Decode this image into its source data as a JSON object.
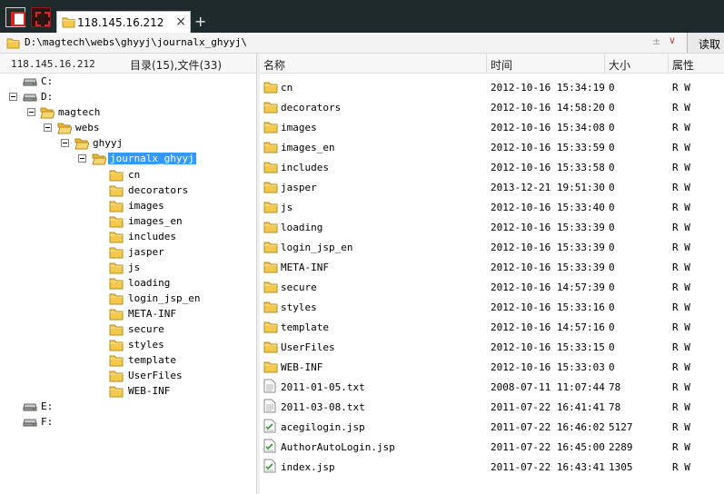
{
  "tab": {
    "title": "118.145.16.212",
    "close": "×",
    "new_tab": "+"
  },
  "address": {
    "path": "D:\\magtech\\webs\\ghyyj\\journalx_ghyyj\\",
    "scroll_glyph": "±",
    "dropdown_glyph": "∨",
    "read_label": "读取"
  },
  "left_header": {
    "host": "118.145.16.212",
    "counts": "目录(15),文件(33)"
  },
  "tree": {
    "c": "C:",
    "d": "D:",
    "magtech": "magtech",
    "webs": "webs",
    "ghyyj": "ghyyj",
    "journalx": "journalx_ghyyj",
    "e": "E:",
    "f": "F:",
    "children": [
      "cn",
      "decorators",
      "images",
      "images_en",
      "includes",
      "jasper",
      "js",
      "loading",
      "login_jsp_en",
      "META-INF",
      "secure",
      "styles",
      "template",
      "UserFiles",
      "WEB-INF"
    ]
  },
  "columns": {
    "name": "名称",
    "time": "时间",
    "size": "大小",
    "attr": "属性"
  },
  "files": [
    {
      "name": "cn",
      "time": "2012-10-16 15:34:19",
      "size": "0",
      "attr": "R W",
      "type": "folder"
    },
    {
      "name": "decorators",
      "time": "2012-10-16 14:58:20",
      "size": "0",
      "attr": "R W",
      "type": "folder"
    },
    {
      "name": "images",
      "time": "2012-10-16 15:34:08",
      "size": "0",
      "attr": "R W",
      "type": "folder"
    },
    {
      "name": "images_en",
      "time": "2012-10-16 15:33:59",
      "size": "0",
      "attr": "R W",
      "type": "folder"
    },
    {
      "name": "includes",
      "time": "2012-10-16 15:33:58",
      "size": "0",
      "attr": "R W",
      "type": "folder"
    },
    {
      "name": "jasper",
      "time": "2013-12-21 19:51:30",
      "size": "0",
      "attr": "R W",
      "type": "folder"
    },
    {
      "name": "js",
      "time": "2012-10-16 15:33:40",
      "size": "0",
      "attr": "R W",
      "type": "folder"
    },
    {
      "name": "loading",
      "time": "2012-10-16 15:33:39",
      "size": "0",
      "attr": "R W",
      "type": "folder"
    },
    {
      "name": "login_jsp_en",
      "time": "2012-10-16 15:33:39",
      "size": "0",
      "attr": "R W",
      "type": "folder"
    },
    {
      "name": "META-INF",
      "time": "2012-10-16 15:33:39",
      "size": "0",
      "attr": "R W",
      "type": "folder"
    },
    {
      "name": "secure",
      "time": "2012-10-16 14:57:39",
      "size": "0",
      "attr": "R W",
      "type": "folder"
    },
    {
      "name": "styles",
      "time": "2012-10-16 15:33:16",
      "size": "0",
      "attr": "R W",
      "type": "folder"
    },
    {
      "name": "template",
      "time": "2012-10-16 14:57:16",
      "size": "0",
      "attr": "R W",
      "type": "folder"
    },
    {
      "name": "UserFiles",
      "time": "2012-10-16 15:33:15",
      "size": "0",
      "attr": "R W",
      "type": "folder"
    },
    {
      "name": "WEB-INF",
      "time": "2012-10-16 15:33:03",
      "size": "0",
      "attr": "R W",
      "type": "folder"
    },
    {
      "name": "2011-01-05.txt",
      "time": "2008-07-11 11:07:44",
      "size": "78",
      "attr": "R W",
      "type": "txt"
    },
    {
      "name": "2011-03-08.txt",
      "time": "2011-07-22 16:41:41",
      "size": "78",
      "attr": "R W",
      "type": "txt"
    },
    {
      "name": "acegilogin.jsp",
      "time": "2011-07-22 16:46:02",
      "size": "5127",
      "attr": "R W",
      "type": "jsp"
    },
    {
      "name": "AuthorAutoLogin.jsp",
      "time": "2011-07-22 16:45:00",
      "size": "2289",
      "attr": "R W",
      "type": "jsp"
    },
    {
      "name": "index.jsp",
      "time": "2011-07-22 16:43:41",
      "size": "1305",
      "attr": "R W",
      "type": "jsp"
    }
  ],
  "colors": {
    "titlebar": "#1e2a2c",
    "folder": "#f2c94c",
    "selection": "#3399ff"
  },
  "icons": {
    "folder": "folder-icon",
    "drive": "drive-icon",
    "text_file": "text-file-icon",
    "jsp_file": "jsp-file-icon"
  }
}
